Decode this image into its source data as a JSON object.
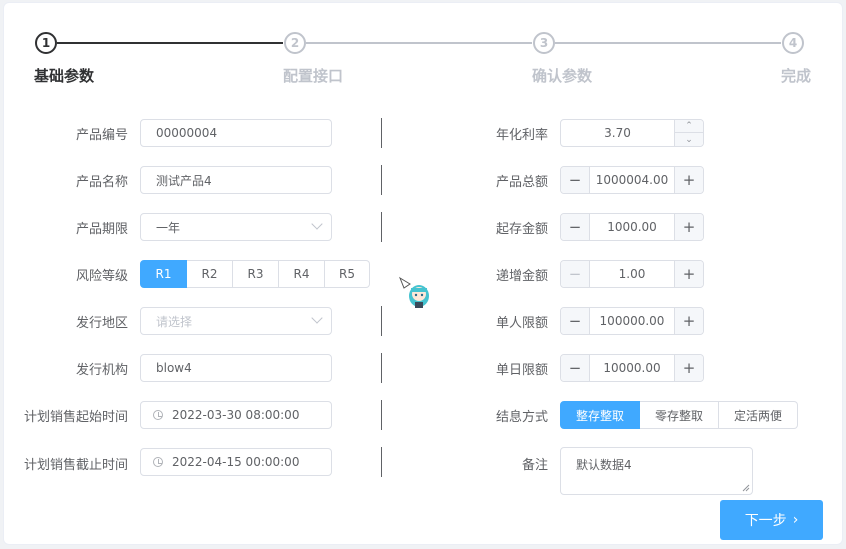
{
  "steps": [
    {
      "num": "1",
      "title": "基础参数",
      "active": true
    },
    {
      "num": "2",
      "title": "配置接口",
      "active": false
    },
    {
      "num": "3",
      "title": "确认参数",
      "active": false
    },
    {
      "num": "4",
      "title": "完成",
      "active": false
    }
  ],
  "left_form": {
    "product_code": {
      "label": "产品编号",
      "value": "00000004"
    },
    "product_name": {
      "label": "产品名称",
      "value": "测试产品4"
    },
    "product_term": {
      "label": "产品期限",
      "value": "一年"
    },
    "risk_level": {
      "label": "风险等级",
      "options": [
        "R1",
        "R2",
        "R3",
        "R4",
        "R5"
      ],
      "selected": "R1"
    },
    "region": {
      "label": "发行地区",
      "placeholder": "请选择"
    },
    "issuer": {
      "label": "发行机构",
      "value": "blow4"
    },
    "sale_start": {
      "label": "计划销售起始时间",
      "value": "2022-03-30 08:00:00"
    },
    "sale_end": {
      "label": "计划销售截止时间",
      "value": "2022-04-15 00:00:00"
    }
  },
  "right_form": {
    "annual_rate": {
      "label": "年化利率",
      "value": "3.70"
    },
    "total_amount": {
      "label": "产品总额",
      "value": "1000004.00"
    },
    "min_deposit": {
      "label": "起存金额",
      "value": "1000.00"
    },
    "increment": {
      "label": "递增金额",
      "value": "1.00"
    },
    "per_person_limit": {
      "label": "单人限额",
      "value": "100000.00"
    },
    "daily_limit": {
      "label": "单日限额",
      "value": "10000.00"
    },
    "settlement": {
      "label": "结息方式",
      "options": [
        "整存整取",
        "零存整取",
        "定活两便"
      ],
      "selected": "整存整取"
    },
    "remark": {
      "label": "备注",
      "value": "默认数据4"
    }
  },
  "buttons": {
    "next": "下一步",
    "next_icon": "chevron-right-icon"
  },
  "colors": {
    "accent": "#40a9ff",
    "active_step": "#303133",
    "inactive_step": "#c0c4cc"
  }
}
